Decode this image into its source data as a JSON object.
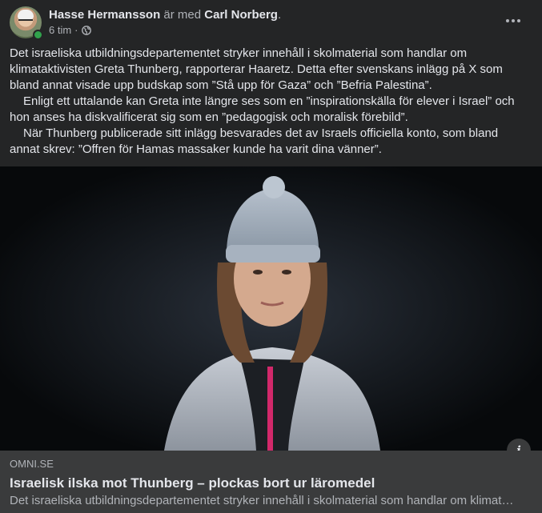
{
  "header": {
    "author": "Hasse Hermansson",
    "with_text": "är med",
    "tagged": "Carl Norberg",
    "period": ".",
    "time": "6 tim",
    "separator": "·",
    "audience_icon": "globe-icon",
    "online_status_color": "#31a24c"
  },
  "post": {
    "paragraphs": [
      "Det israeliska utbildningsdepartementet stryker innehåll i skolmaterial som handlar om klimataktivisten Greta Thunberg, rapporterar Haaretz. Detta efter svenskans inlägg på X som bland annat visade upp budskap som ”Stå upp för Gaza” och ”Befria Palestina”.",
      "Enligt ett uttalande kan Greta inte längre ses som en ”inspirationskälla för elever i Israel” och hon anses ha diskvalificerat sig som en ”pedagogisk och moralisk förebild”.",
      "När Thunberg publicerade sitt inlägg besvarades det av Israels officiella konto, som bland annat skrev: ”Offren för Hamas massaker kunde ha varit dina vänner”."
    ]
  },
  "link_preview": {
    "source": "OMNI.SE",
    "title": "Israelisk ilska mot Thunberg – plockas bort ur läromedel",
    "description": "Det israeliska utbildningsdepartementet stryker innehåll i skolmaterial som handlar om klimataktivisten Greta Thunberg"
  },
  "colors": {
    "background": "#242526",
    "link_preview_bg": "#3a3b3c",
    "text": "#e4e6eb",
    "muted_text": "#b0b3b8"
  }
}
